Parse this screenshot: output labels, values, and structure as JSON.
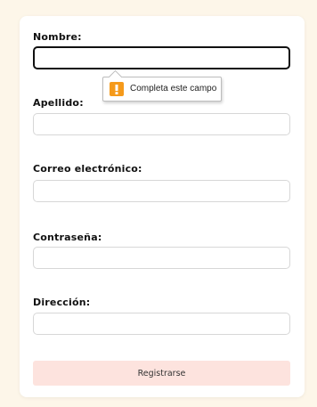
{
  "form": {
    "fields": [
      {
        "label": "Nombre:",
        "value": ""
      },
      {
        "label": "Apellido:",
        "value": ""
      },
      {
        "label": "Correo electrónico:",
        "value": ""
      },
      {
        "label": "Contraseña:",
        "value": ""
      },
      {
        "label": "Dirección:",
        "value": ""
      }
    ],
    "submit_label": "Registrarse"
  },
  "validation": {
    "message": "Completa este campo",
    "icon": "warning-icon"
  },
  "colors": {
    "page_background": "#fdf6e9",
    "card_background": "#ffffff",
    "submit_background": "#fde3de",
    "warning_accent": "#f59a1b"
  }
}
